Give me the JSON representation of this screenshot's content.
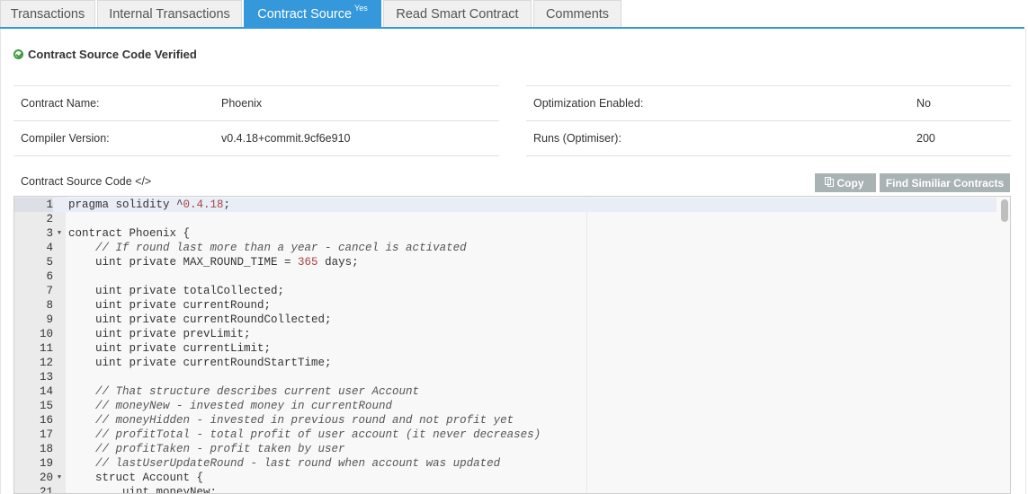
{
  "tabs": [
    {
      "label": "Transactions",
      "sup": ""
    },
    {
      "label": "Internal Transactions",
      "sup": ""
    },
    {
      "label": "Contract Source",
      "sup": "Yes"
    },
    {
      "label": "Read Smart Contract",
      "sup": ""
    },
    {
      "label": "Comments",
      "sup": ""
    }
  ],
  "verified_text": "Contract Source Code Verified",
  "info_left": [
    {
      "label": "Contract Name:",
      "value": "Phoenix"
    },
    {
      "label": "Compiler Version:",
      "value": "v0.4.18+commit.9cf6e910"
    }
  ],
  "info_right": [
    {
      "label": "Optimization Enabled:",
      "value": "No"
    },
    {
      "label": "Runs (Optimiser):",
      "value": "200"
    }
  ],
  "source_label": "Contract Source Code </>",
  "buttons": {
    "copy": "Copy",
    "find_similar": "Find Similiar Contracts"
  },
  "code_lines": [
    {
      "n": "1",
      "fold": "",
      "text": "pragma solidity ^",
      "num": "0.4.18",
      "after": ";",
      "comment": false
    },
    {
      "n": "2",
      "fold": "",
      "text": "",
      "num": "",
      "after": "",
      "comment": false
    },
    {
      "n": "3",
      "fold": "▼",
      "text": "contract Phoenix {",
      "num": "",
      "after": "",
      "comment": false
    },
    {
      "n": "4",
      "fold": "",
      "text": "    // If round last more than a year - cancel is activated",
      "num": "",
      "after": "",
      "comment": true
    },
    {
      "n": "5",
      "fold": "",
      "text": "    uint private MAX_ROUND_TIME = ",
      "num": "365",
      "after": " days;",
      "comment": false
    },
    {
      "n": "6",
      "fold": "",
      "text": "",
      "num": "",
      "after": "",
      "comment": false
    },
    {
      "n": "7",
      "fold": "",
      "text": "    uint private totalCollected;",
      "num": "",
      "after": "",
      "comment": false
    },
    {
      "n": "8",
      "fold": "",
      "text": "    uint private currentRound;",
      "num": "",
      "after": "",
      "comment": false
    },
    {
      "n": "9",
      "fold": "",
      "text": "    uint private currentRoundCollected;",
      "num": "",
      "after": "",
      "comment": false
    },
    {
      "n": "10",
      "fold": "",
      "text": "    uint private prevLimit;",
      "num": "",
      "after": "",
      "comment": false
    },
    {
      "n": "11",
      "fold": "",
      "text": "    uint private currentLimit;",
      "num": "",
      "after": "",
      "comment": false
    },
    {
      "n": "12",
      "fold": "",
      "text": "    uint private currentRoundStartTime;",
      "num": "",
      "after": "",
      "comment": false
    },
    {
      "n": "13",
      "fold": "",
      "text": "",
      "num": "",
      "after": "",
      "comment": false
    },
    {
      "n": "14",
      "fold": "",
      "text": "    // That structure describes current user Account",
      "num": "",
      "after": "",
      "comment": true
    },
    {
      "n": "15",
      "fold": "",
      "text": "    // moneyNew - invested money in currentRound",
      "num": "",
      "after": "",
      "comment": true
    },
    {
      "n": "16",
      "fold": "",
      "text": "    // moneyHidden - invested in previous round and not profit yet",
      "num": "",
      "after": "",
      "comment": true
    },
    {
      "n": "17",
      "fold": "",
      "text": "    // profitTotal - total profit of user account (it never decreases)",
      "num": "",
      "after": "",
      "comment": true
    },
    {
      "n": "18",
      "fold": "",
      "text": "    // profitTaken - profit taken by user",
      "num": "",
      "after": "",
      "comment": true
    },
    {
      "n": "19",
      "fold": "",
      "text": "    // lastUserUpdateRound - last round when account was updated",
      "num": "",
      "after": "",
      "comment": true
    },
    {
      "n": "20",
      "fold": "▼",
      "text": "    struct Account {",
      "num": "",
      "after": "",
      "comment": false
    },
    {
      "n": "21",
      "fold": "",
      "text": "        uint moneyNew;",
      "num": "",
      "after": "",
      "comment": false
    }
  ]
}
